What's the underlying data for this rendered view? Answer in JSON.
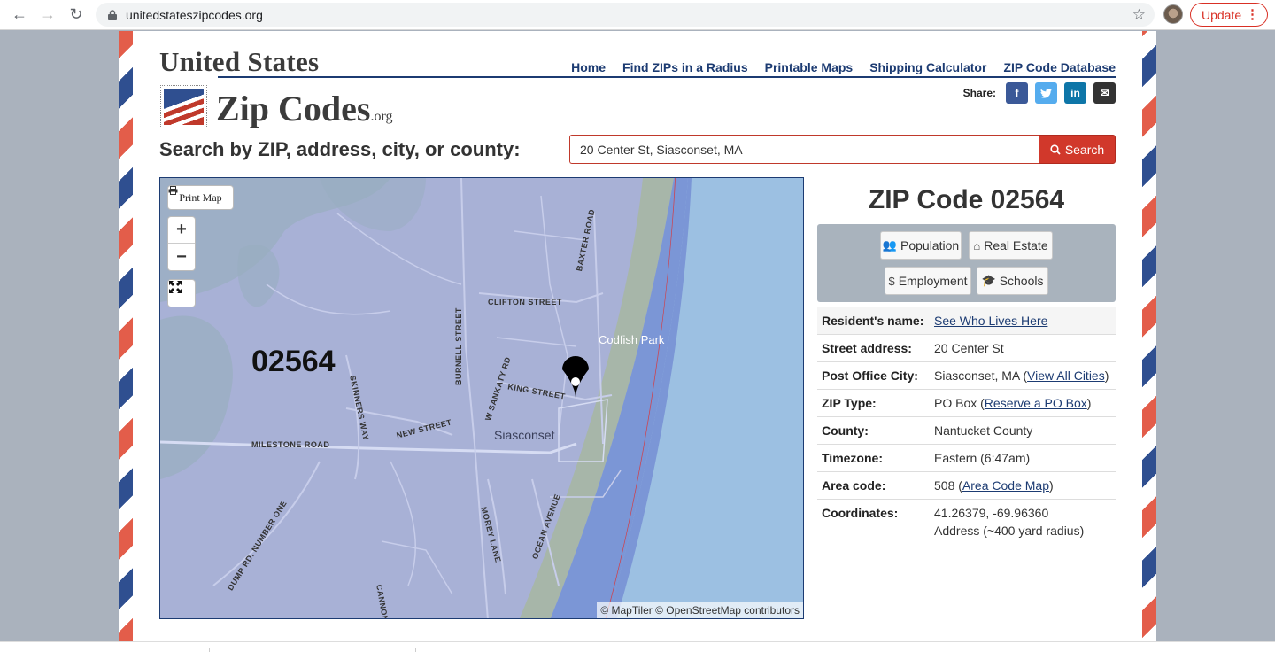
{
  "browser": {
    "url": "unitedstateszipcodes.org",
    "update_label": "Update"
  },
  "logo": {
    "line1": "United States",
    "line2": "Zip Codes",
    "suffix": ".org"
  },
  "nav": {
    "items": [
      "Home",
      "Find ZIPs in a Radius",
      "Printable Maps",
      "Shipping Calculator",
      "ZIP Code Database"
    ]
  },
  "share": {
    "label": "Share:",
    "buttons": [
      {
        "name": "facebook",
        "glyph": "f",
        "color": "#3b5998"
      },
      {
        "name": "twitter",
        "glyph": "t",
        "color": "#55acee"
      },
      {
        "name": "linkedin",
        "glyph": "in",
        "color": "#0e76a8"
      },
      {
        "name": "email",
        "glyph": "✉",
        "color": "#333333"
      }
    ]
  },
  "search": {
    "label": "Search by ZIP, address, city, or county:",
    "value": "20 Center St, Siasconset, MA",
    "button_label": "Search"
  },
  "map": {
    "print_label": "Print Map",
    "zoom_in": "+",
    "zoom_out": "−",
    "zip_overlay": "02564",
    "attribution": "© MapTiler © OpenStreetMap contributors",
    "places": [
      "CLIFTON STREET",
      "BAXTER ROAD",
      "Codfish Park",
      "BURNELL STREET",
      "W SANKATY RD",
      "KING STREET",
      "SKINNERS WAY",
      "NEW STREET",
      "Siasconset",
      "MILESTONE ROAD",
      "DUMP RD. NUMBER ONE",
      "MOREY LANE",
      "OCEAN AVENUE",
      "CANNON"
    ]
  },
  "info": {
    "title": "ZIP Code 02564",
    "categories": [
      "Population",
      "Real Estate",
      "Employment",
      "Schools"
    ],
    "rows": [
      {
        "key": "Resident's name:",
        "link": "See Who Lives Here"
      },
      {
        "key": "Street address:",
        "value": "20 Center St"
      },
      {
        "key": "Post Office City:",
        "value": "Siasconset, MA (",
        "link": "View All Cities",
        "after": ")"
      },
      {
        "key": "ZIP Type:",
        "value": "PO Box (",
        "link": "Reserve a PO Box",
        "after": ")"
      },
      {
        "key": "County:",
        "value": "Nantucket County"
      },
      {
        "key": "Timezone:",
        "value": "Eastern (6:47am)"
      },
      {
        "key": "Area code:",
        "value": "508 (",
        "link": "Area Code Map",
        "after": ")"
      },
      {
        "key": "Coordinates:",
        "value": "41.26379, -69.96360",
        "value2": "Address (~400 yard radius)"
      }
    ]
  }
}
